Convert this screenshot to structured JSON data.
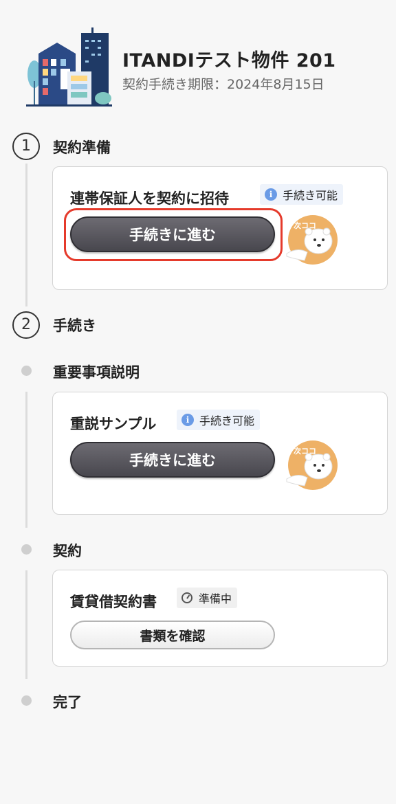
{
  "header": {
    "property_title": "ITANDIテスト物件 201",
    "deadline": "契約手続き期限：2024年8月15日",
    "building_icon": "building-illustration"
  },
  "steps": [
    {
      "number": "1",
      "label": "契約準備"
    },
    {
      "number": "2",
      "label": "手続き"
    }
  ],
  "substeps": [
    {
      "label": "重要事項説明"
    },
    {
      "label": "契約"
    },
    {
      "label": "完了"
    }
  ],
  "cards": [
    {
      "title": "連帯保証人を契約に招待",
      "badge": "手続き可能",
      "badge_icon": "info-icon",
      "button": "手続きに進む",
      "mascot": "polar-bear-mascot",
      "mascot_text": "次ココ"
    },
    {
      "title": "重説サンプル",
      "badge": "手続き可能",
      "badge_icon": "info-icon",
      "button": "手続きに進む",
      "mascot": "polar-bear-mascot",
      "mascot_text": "次ココ"
    },
    {
      "title": "賃貸借契約書",
      "badge": "準備中",
      "badge_icon": "clock-icon",
      "button": "書類を確認"
    }
  ],
  "colors": {
    "highlight": "#e53a2b",
    "badge_info": "#6a9be6",
    "mascot": "#eeb166"
  }
}
